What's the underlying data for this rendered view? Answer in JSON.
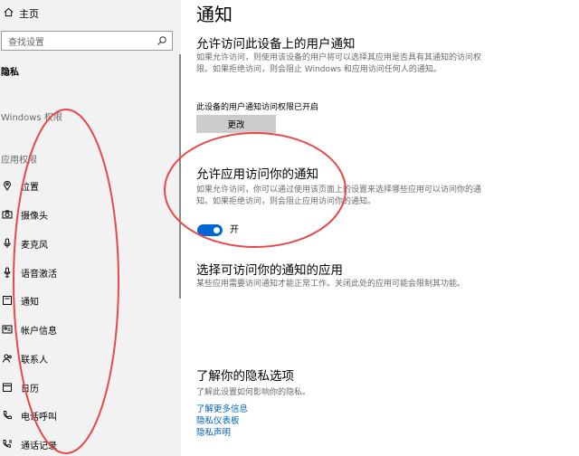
{
  "sidebar": {
    "home_label": "主页",
    "search_placeholder": "查找设置",
    "current_section": "隐私",
    "groups": [
      {
        "label": "Windows 权限"
      },
      {
        "label": "应用权限"
      }
    ],
    "items": [
      {
        "label": "位置",
        "icon": "location-icon"
      },
      {
        "label": "摄像头",
        "icon": "camera-icon"
      },
      {
        "label": "麦克风",
        "icon": "microphone-icon"
      },
      {
        "label": "语音激活",
        "icon": "voice-activation-icon"
      },
      {
        "label": "通知",
        "icon": "notification-icon"
      },
      {
        "label": "帐户信息",
        "icon": "account-info-icon"
      },
      {
        "label": "联系人",
        "icon": "contacts-icon"
      },
      {
        "label": "日历",
        "icon": "calendar-icon"
      },
      {
        "label": "电话呼叫",
        "icon": "phone-icon"
      },
      {
        "label": "通话记录",
        "icon": "call-history-icon"
      }
    ]
  },
  "main": {
    "title": "通知",
    "device_access": {
      "heading": "允许访问此设备上的用户通知",
      "description": "如果允许访问，则使用该设备的用户将可以选择其应用是否具有其通知的访问权限。如果拒绝访问，则会阻止 Windows 和应用访问任何人的通知。",
      "status": "此设备的用户通知访问权限已开启",
      "change_button": "更改"
    },
    "app_access": {
      "heading": "允许应用访问你的通知",
      "description": "如果允许访问，你可以通过使用该页面上的设置来选择哪些应用可以访问你的通知。如果拒绝访问，则会阻止应用访问你的通知。",
      "toggle_state": "开",
      "toggle_on": true
    },
    "choose_apps": {
      "heading": "选择可访问你的通知的应用",
      "description": "某些应用需要访问通知才能正常工作。关闭此处的应用可能会限制其功能。"
    },
    "privacy": {
      "heading": "了解你的隐私选项",
      "description": "了解此设置如何影响你的隐私。",
      "links": [
        "了解更多信息",
        "隐私仪表板",
        "隐私声明"
      ]
    }
  },
  "colors": {
    "accent": "#0066d6",
    "link": "#0063b1",
    "annotation": "#e8484a"
  }
}
